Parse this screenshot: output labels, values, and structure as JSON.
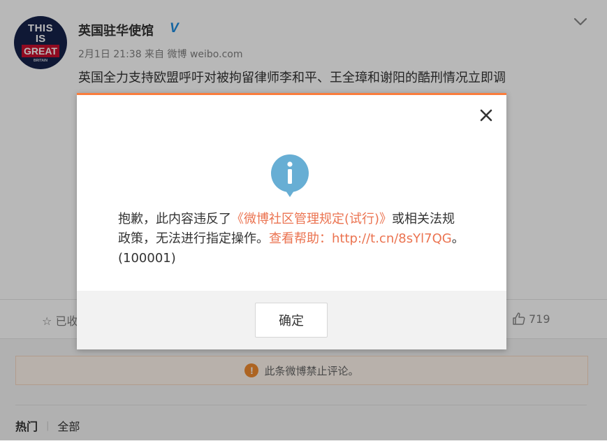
{
  "post": {
    "avatar_text": [
      "THIS",
      "IS",
      "GREAT",
      "BRITAIN"
    ],
    "author_name": "英国驻华使馆",
    "verified_mark": "V",
    "meta": "2月1日 21:38 来自 微博 weibo.com",
    "content": "英国全力支持欧盟呼吁对被拘留律师李和平、王全璋和谢阳的酷刑情况立即调"
  },
  "actions": {
    "favorite_label": "已收藏",
    "like_count": "719"
  },
  "comments": {
    "notice_text": "此条微博禁止评论。",
    "tab_hot": "热门",
    "tab_sep": "|",
    "tab_all": "全部"
  },
  "dialog": {
    "message_1": "抱歉，此内容违反了",
    "message_link1": "《微博社区管理规定(试行)》",
    "message_2": "或相关法规政策，无法进行指定操作。",
    "message_link2": "查看帮助：http://t.cn/8sYl7QG",
    "message_3": "。(100001)",
    "ok_label": "确定"
  },
  "colors": {
    "accent": "#fa7d3c",
    "link": "#eb7350",
    "info_icon": "#67aed4",
    "verified": "#1d8ce0",
    "notice_icon": "#f08b30"
  }
}
